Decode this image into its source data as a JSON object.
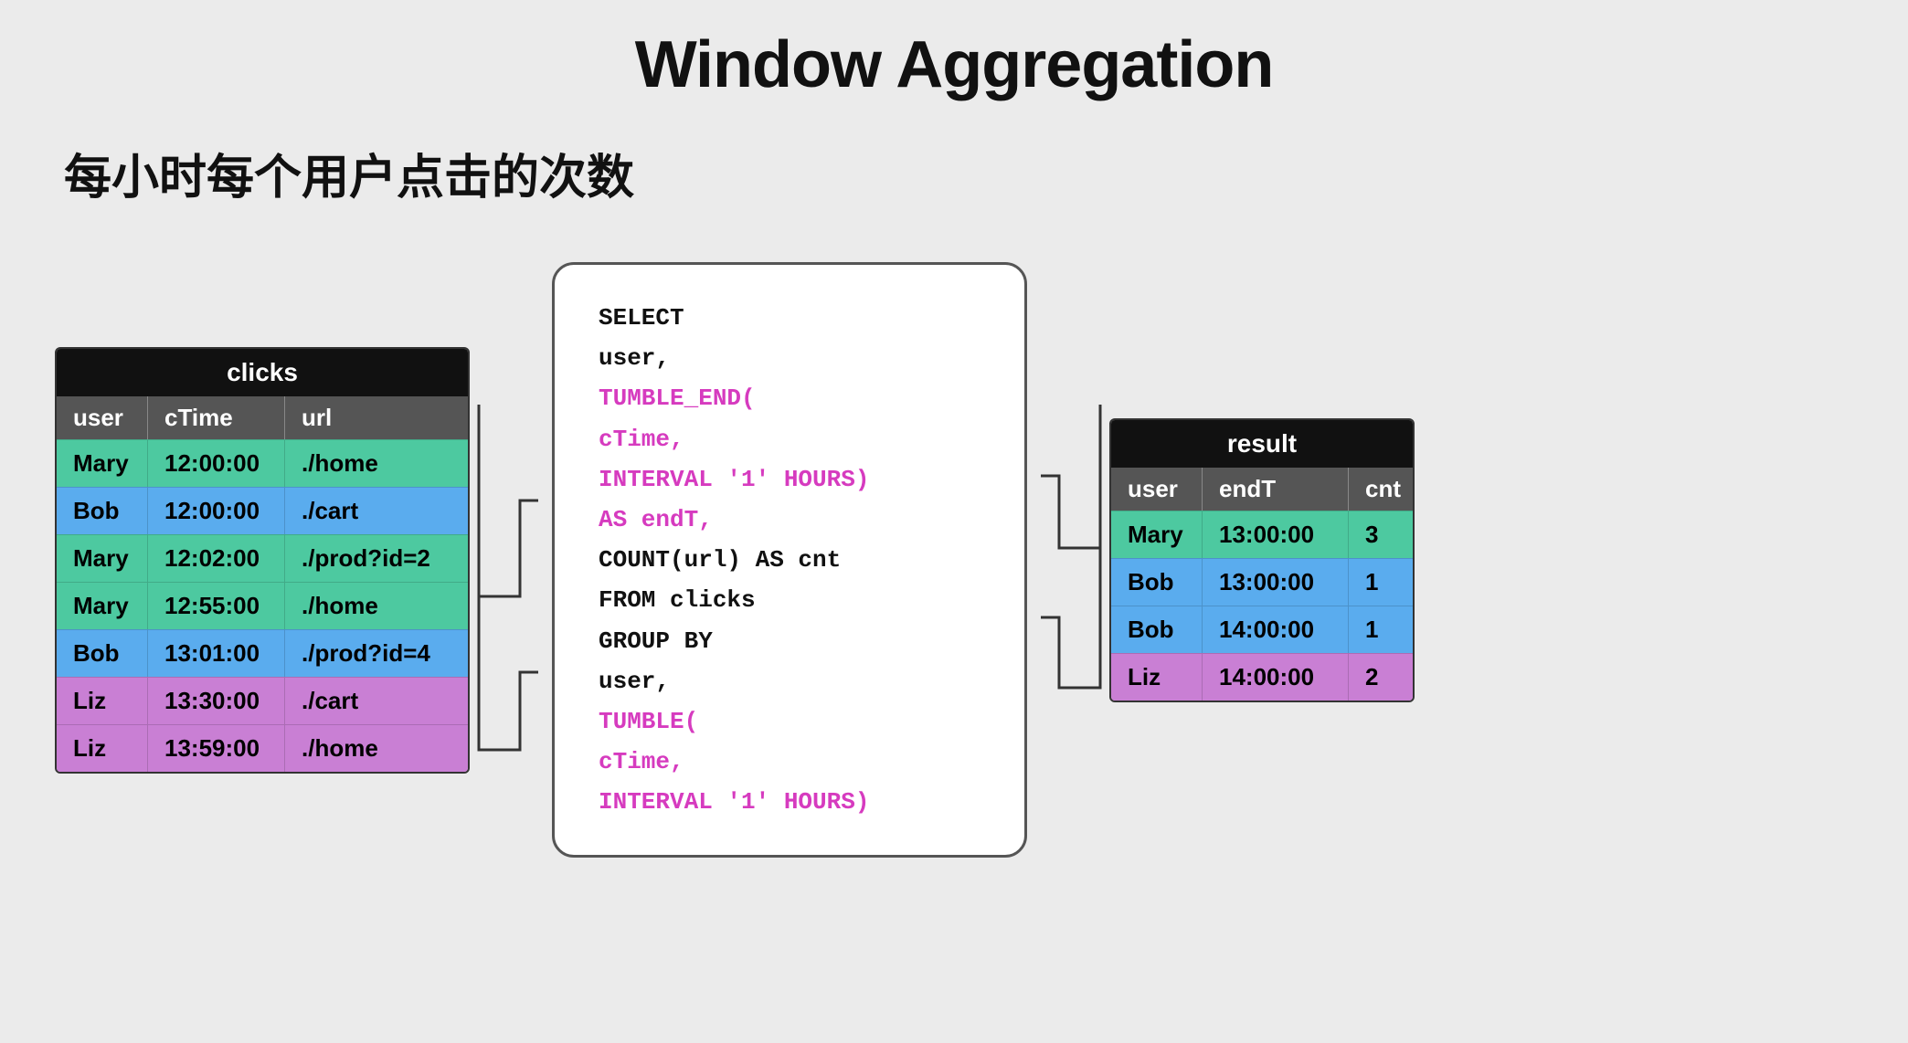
{
  "page": {
    "title": "Window Aggregation",
    "subtitle": "每小时每个用户点击的次数"
  },
  "clicks_table": {
    "header": "clicks",
    "columns": [
      "user",
      "cTime",
      "url"
    ],
    "rows": [
      {
        "user": "Mary",
        "cTime": "12:00:00",
        "url": "./home",
        "color": "green"
      },
      {
        "user": "Bob",
        "cTime": "12:00:00",
        "url": "./cart",
        "color": "blue"
      },
      {
        "user": "Mary",
        "cTime": "12:02:00",
        "url": "./prod?id=2",
        "color": "green"
      },
      {
        "user": "Mary",
        "cTime": "12:55:00",
        "url": "./home",
        "color": "green"
      },
      {
        "user": "Bob",
        "cTime": "13:01:00",
        "url": "./prod?id=4",
        "color": "blue"
      },
      {
        "user": "Liz",
        "cTime": "13:30:00",
        "url": "./cart",
        "color": "purple"
      },
      {
        "user": "Liz",
        "cTime": "13:59:00",
        "url": "./home",
        "color": "purple"
      }
    ]
  },
  "sql": {
    "line1": "SELECT",
    "line2": "  user,",
    "line3": "  TUMBLE_END(",
    "line4": "    cTime,",
    "line5": "    INTERVAL '1' HOURS)",
    "line6": "  AS endT,",
    "line7": "  COUNT(url) AS cnt",
    "line8": "FROM clicks",
    "line9": "GROUP BY",
    "line10": "  user,",
    "line11": "  TUMBLE(",
    "line12": "    cTime,",
    "line13": "    INTERVAL '1' HOURS)"
  },
  "result_table": {
    "header": "result",
    "columns": [
      "user",
      "endT",
      "cnt"
    ],
    "rows": [
      {
        "user": "Mary",
        "endT": "13:00:00",
        "cnt": "3",
        "color": "green"
      },
      {
        "user": "Bob",
        "endT": "13:00:00",
        "cnt": "1",
        "color": "blue"
      },
      {
        "user": "Bob",
        "endT": "14:00:00",
        "cnt": "1",
        "color": "blue"
      },
      {
        "user": "Liz",
        "endT": "14:00:00",
        "cnt": "2",
        "color": "purple"
      }
    ]
  }
}
